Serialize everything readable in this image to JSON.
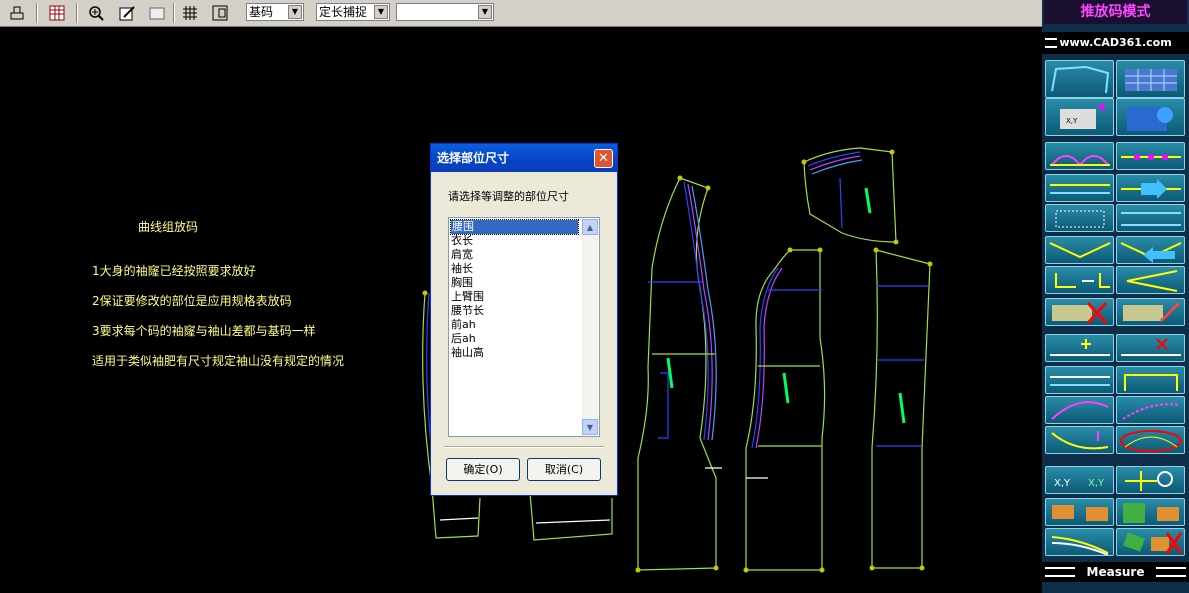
{
  "toolbar": {
    "buttons": [
      "select-icon",
      "table-icon",
      "zoom-in-icon",
      "edit-pen-icon",
      "rectangle-icon",
      "grid-icon",
      "window-icon"
    ],
    "base_size_value": "基码",
    "snap_mode_value": "定长捕捉",
    "third_combo_value": ""
  },
  "canvas": {
    "notes": {
      "title": "曲线组放码",
      "line1": "1大身的袖窿已经按照要求放好",
      "line2": "2保证要修改的部位是应用规格表放码",
      "line3": "3要求每个码的袖窿与袖山差都与基码一样",
      "line4": "适用于类似袖肥有尺寸规定袖山没有规定的情况"
    }
  },
  "dialog": {
    "title": "选择部位尺寸",
    "prompt": "请选择等调整的部位尺寸",
    "items": [
      "腰围",
      "衣长",
      "肩宽",
      "袖长",
      "胸围",
      "上臂围",
      "腰节长",
      "前ah",
      "后ah",
      "袖山高"
    ],
    "selected_index": 0,
    "ok_label": "确定(O)",
    "cancel_label": "取消(C)"
  },
  "right_panel": {
    "title": "推放码模式",
    "url": "www.CAD361.com",
    "measure_label": "Measure"
  },
  "colors": {
    "pattern_outline": "#a0e040",
    "grade_blue": "#3040ff",
    "grade_purple": "#c040ff",
    "node_yellow": "#d0d000",
    "note_text": "#ffff80"
  }
}
